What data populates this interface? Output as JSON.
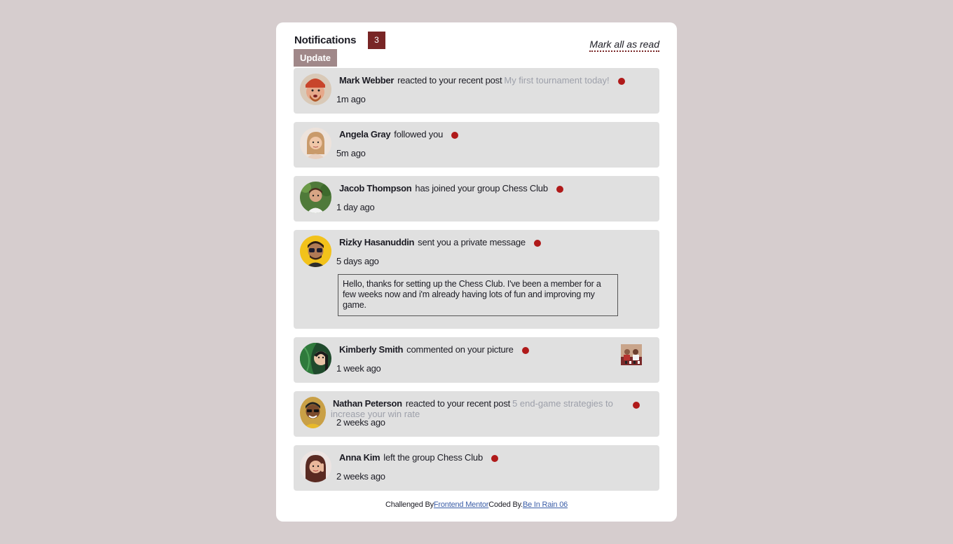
{
  "header": {
    "title": "Notifications",
    "unread_count": "3",
    "update_label": "Update",
    "mark_all_label": "Mark all as read"
  },
  "notifications": [
    {
      "name": "Mark Webber",
      "action": "reacted to your recent post",
      "post": "My first tournament today!",
      "time": "1m ago",
      "avatar_icon": "mark-webber-avatar"
    },
    {
      "name": "Angela Gray",
      "action": "followed you",
      "time": "5m ago",
      "avatar_icon": "angela-gray-avatar"
    },
    {
      "name": "Jacob Thompson",
      "action": "has joined your group Chess Club",
      "time": "1 day ago",
      "avatar_icon": "jacob-thompson-avatar"
    },
    {
      "name": "Rizky Hasanuddin",
      "action": "sent you a private message",
      "time": "5 days ago",
      "message": "Hello, thanks for setting up the Chess Club. I've been a member for a few weeks now and i'm already having lots of fun and improving my game.",
      "avatar_icon": "rizky-hasanuddin-avatar"
    },
    {
      "name": "Kimberly Smith",
      "action": "commented on your picture",
      "time": "1 week ago",
      "avatar_icon": "kimberly-smith-avatar"
    },
    {
      "name": "Nathan Peterson",
      "action": "reacted to your recent post",
      "post": "5 end-game strategies to increase your win rate",
      "time": "2 weeks ago",
      "avatar_icon": "nathan-peterson-avatar"
    },
    {
      "name": "Anna Kim",
      "action": "left the group Chess Club",
      "time": "2 weeks ago",
      "avatar_icon": "anna-kim-avatar"
    }
  ],
  "footer": {
    "challenged_label": "Challenged By",
    "challenge_link": "Frontend Mentor",
    "coded_label": "Coded By.",
    "coder_link": "Be In Rain 06"
  },
  "colors": {
    "background": "#d6cdce",
    "badge": "#782525",
    "update_button": "#a08889",
    "unread_dot": "#b01a1a",
    "post_link": "#9da0aa",
    "footer_link": "#3b5ea8"
  }
}
